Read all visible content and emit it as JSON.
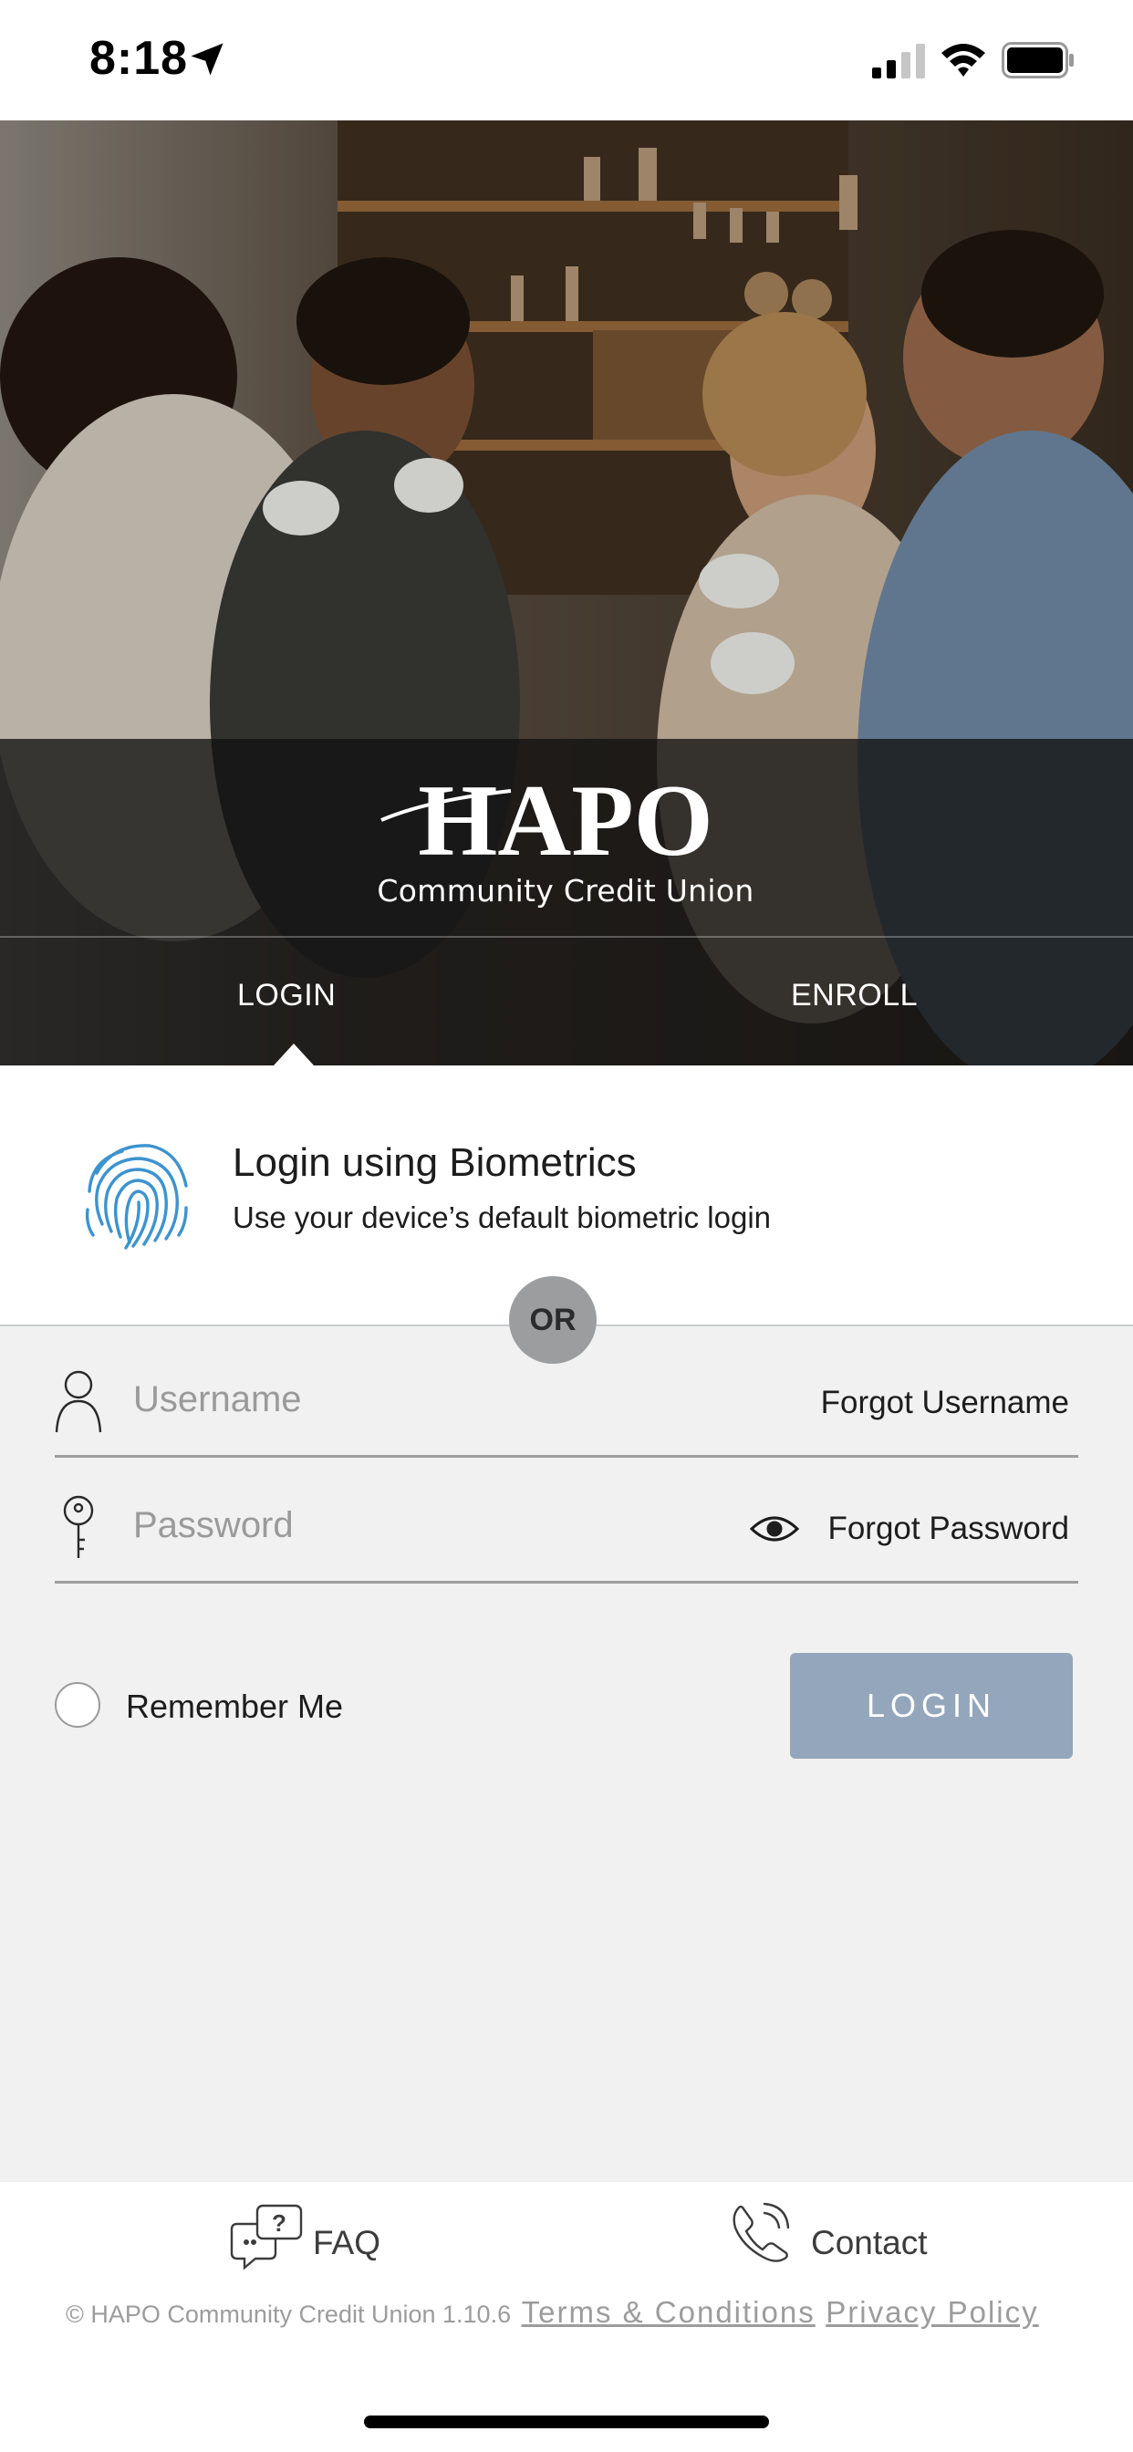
{
  "status_bar": {
    "time": "8:18",
    "icons": [
      "location-arrow-icon",
      "signal-icon",
      "wifi-icon",
      "battery-icon"
    ]
  },
  "brand": {
    "logo_text": "HAPO",
    "subtitle": "Community Credit Union"
  },
  "tabs": [
    {
      "label": "LOGIN",
      "active": true
    },
    {
      "label": "ENROLL",
      "active": false
    }
  ],
  "biometrics": {
    "icon": "fingerprint-icon",
    "title": "Login using Biometrics",
    "subtitle": "Use your device’s default biometric login"
  },
  "divider_label": "OR",
  "form": {
    "username": {
      "placeholder": "Username",
      "value": "",
      "icon": "user-icon",
      "link": "Forgot Username"
    },
    "password": {
      "placeholder": "Password",
      "value": "",
      "icon": "key-icon",
      "link": "Forgot Password",
      "toggle_icon": "eye-icon"
    },
    "remember_label": "Remember Me",
    "remember_checked": false,
    "submit_label": "LOGIN"
  },
  "footer": {
    "faq_label": "FAQ",
    "contact_label": "Contact",
    "copyright": "© HAPO Community Credit Union 1.10.6",
    "terms_label": "Terms & Conditions",
    "privacy_label": "Privacy Policy"
  },
  "colors": {
    "accent_button": "#94a6bb",
    "fingerprint": "#3d93cf",
    "form_background": "#f0f1f0",
    "or_badge": "#9b9d9f"
  }
}
